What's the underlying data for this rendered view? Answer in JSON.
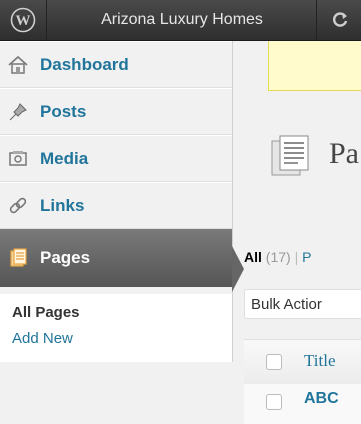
{
  "adminbar": {
    "logo_icon": "wordpress-logo-icon",
    "site_name": "Arizona Luxury Homes",
    "refresh_icon": "refresh-icon"
  },
  "sidebar": {
    "items": [
      {
        "label": "Dashboard",
        "icon": "home-icon"
      },
      {
        "label": "Posts",
        "icon": "pin-icon"
      },
      {
        "label": "Media",
        "icon": "media-icon"
      },
      {
        "label": "Links",
        "icon": "link-icon"
      },
      {
        "label": "Pages",
        "icon": "pages-icon",
        "current": true
      }
    ],
    "submenu": [
      {
        "label": "All Pages",
        "active": true
      },
      {
        "label": "Add New"
      }
    ]
  },
  "main": {
    "page_title": "Pa",
    "filters": {
      "all_label": "All",
      "all_count": "(17)",
      "separator": "|",
      "next_label": "P"
    },
    "bulk_actions": "Bulk Actior",
    "table": {
      "title_col": "Title",
      "first_row_title": "ABC"
    }
  },
  "colors": {
    "link": "#21759b",
    "adminbar": "#2e2e2e",
    "current_menu": "#666666",
    "notice_bg": "#fffbcc"
  }
}
